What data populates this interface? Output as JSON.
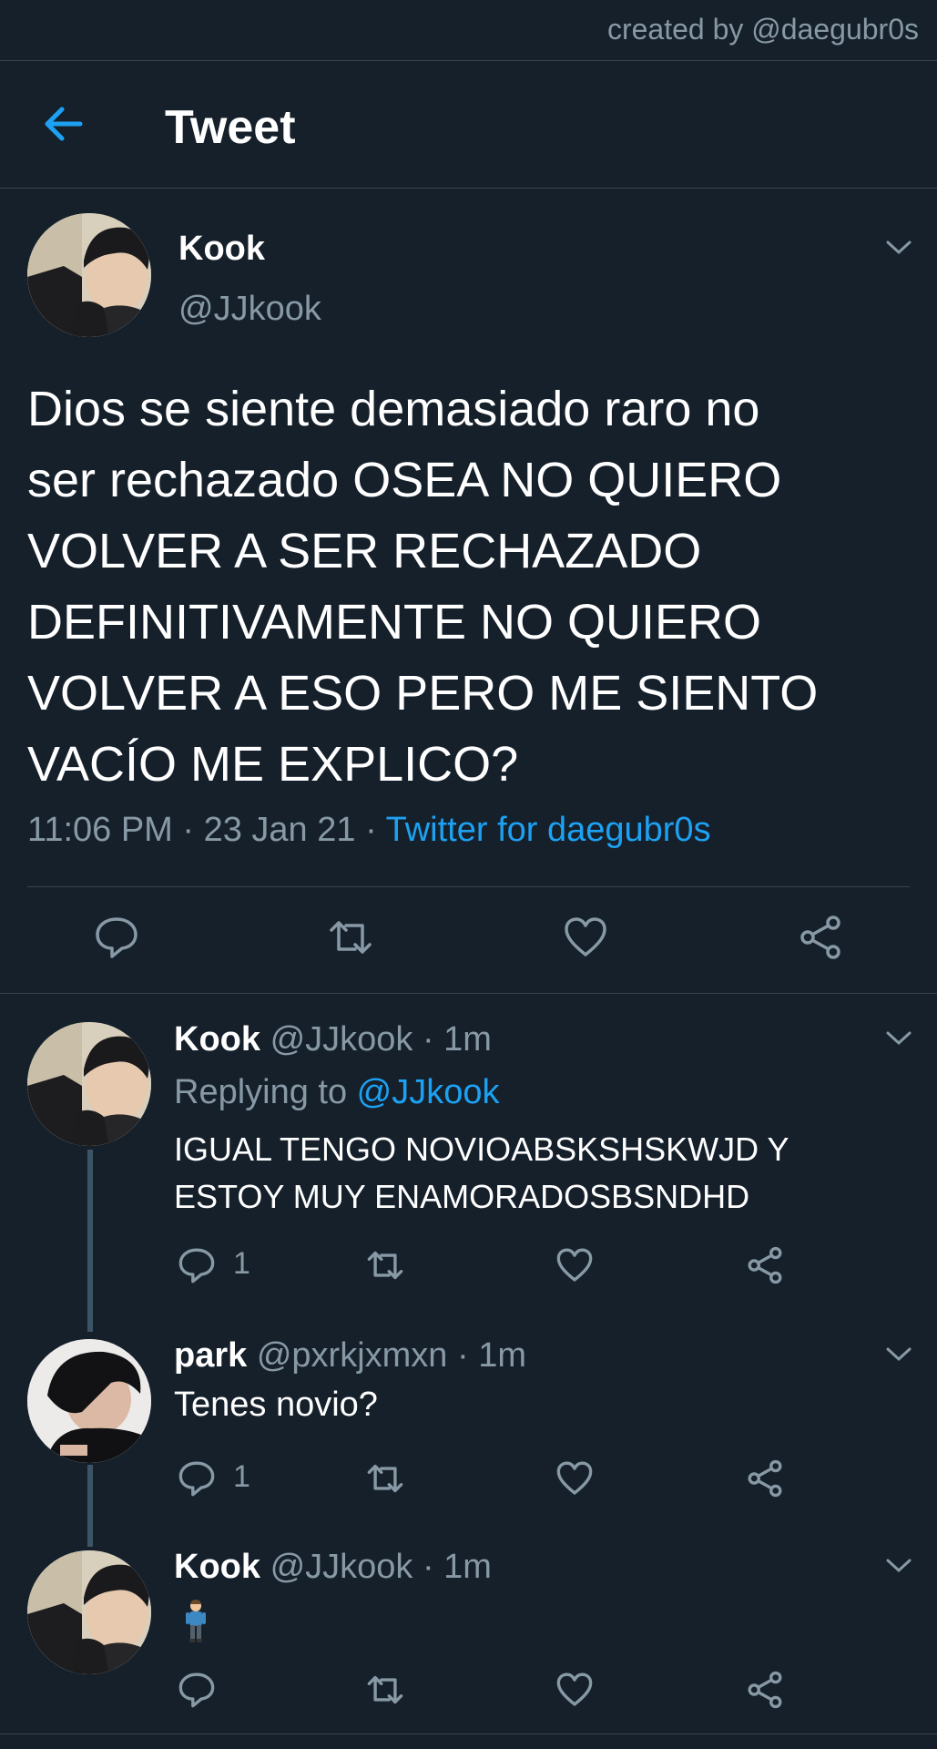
{
  "watermark": "created by @daegubr0s",
  "header": {
    "title": "Tweet",
    "back_icon": "arrow-left-icon"
  },
  "colors": {
    "background": "#15202b",
    "accent": "#1da1f2",
    "muted": "#8899a6",
    "divider": "#38444d"
  },
  "main_tweet": {
    "name": "Kook",
    "handle": "@JJkook",
    "text": "Dios se siente demasiado raro no\nser rechazado OSEA NO QUIERO\nVOLVER A SER RECHAZADO\nDEFINITIVAMENTE NO QUIERO\nVOLVER A ESO PERO ME SIENTO\nVACÍO ME EXPLICO?",
    "time": "11:06 PM · 23 Jan 21 · ",
    "source": "Twitter for daegubr0s"
  },
  "replies": [
    {
      "name": "Kook",
      "handle": "@JJkook · 1m",
      "replying_label": "Replying to ",
      "replying_to": "@JJkook",
      "text": "IGUAL TENGO NOVIOABSKSHSKWJD Y\nESTOY MUY ENAMORADOSBSNDHD",
      "reply_count": "1"
    },
    {
      "name": "park",
      "handle": "@pxrkjxmxn · 1m",
      "text": "Tenes novio?",
      "reply_count": "1"
    },
    {
      "name": "Kook",
      "handle": "@JJkook · 1m",
      "emoji": "man-standing-emoji"
    }
  ]
}
